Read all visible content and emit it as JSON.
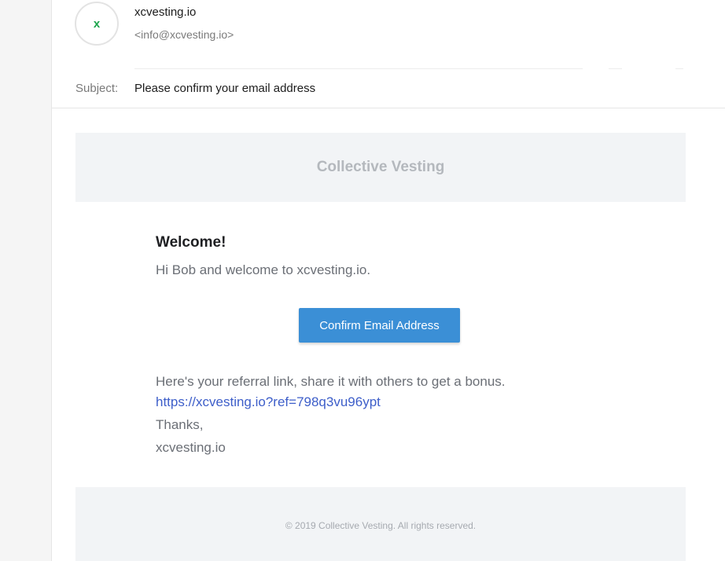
{
  "sender": {
    "avatar_letter": "x",
    "name": "xcvesting.io",
    "email": "<info@xcvesting.io>"
  },
  "subject": {
    "label": "Subject:",
    "value": "Please confirm your email address"
  },
  "email_body": {
    "brand_title": "Collective Vesting",
    "welcome_heading": "Welcome!",
    "intro": "Hi Bob and welcome to xcvesting.io.",
    "confirm_button_label": "Confirm Email Address",
    "referral_text": "Here's your referral link, share it with others to get a bonus.",
    "referral_link": "https://xcvesting.io?ref=798q3vu96ypt",
    "thanks": "Thanks,",
    "signoff": "xcvesting.io",
    "footer": "© 2019 Collective Vesting. All rights reserved."
  },
  "colors": {
    "button_bg": "#3b8fd6",
    "link": "#3d5ec9",
    "avatar_letter": "#1ba44b",
    "banner_bg": "#f2f4f6"
  }
}
